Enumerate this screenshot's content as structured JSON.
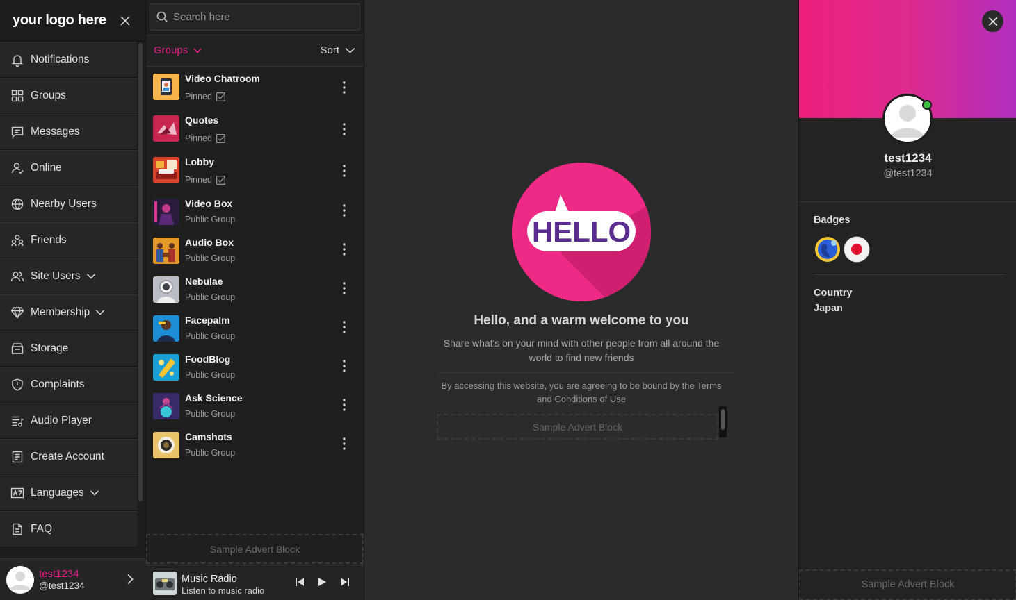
{
  "brand": {
    "logo_text": "your logo here"
  },
  "nav": {
    "items": [
      {
        "label": "Notifications",
        "icon": "bell-icon"
      },
      {
        "label": "Groups",
        "icon": "grid-icon"
      },
      {
        "label": "Messages",
        "icon": "message-icon"
      },
      {
        "label": "Online",
        "icon": "user-check-icon"
      },
      {
        "label": "Nearby Users",
        "icon": "globe-icon"
      },
      {
        "label": "Friends",
        "icon": "friends-icon"
      },
      {
        "label": "Site Users",
        "icon": "users-icon",
        "has_submenu": true
      },
      {
        "label": "Membership",
        "icon": "diamond-icon",
        "has_submenu": true
      },
      {
        "label": "Storage",
        "icon": "storage-icon"
      },
      {
        "label": "Complaints",
        "icon": "shield-icon"
      },
      {
        "label": "Audio Player",
        "icon": "playlist-icon"
      },
      {
        "label": "Create Account",
        "icon": "form-icon"
      },
      {
        "label": "Languages",
        "icon": "language-icon",
        "has_submenu": true
      },
      {
        "label": "FAQ",
        "icon": "document-icon"
      }
    ]
  },
  "current_user": {
    "name": "test1234",
    "handle": "@test1234"
  },
  "search": {
    "placeholder": "Search here",
    "value": ""
  },
  "groups_bar": {
    "tab_label": "Groups",
    "sort_label": "Sort"
  },
  "groups": [
    {
      "name": "Video Chatroom",
      "subtitle": "Pinned",
      "pinned": true,
      "thumb_color": "#f5b34a"
    },
    {
      "name": "Quotes",
      "subtitle": "Pinned",
      "pinned": true,
      "thumb_color": "#c9264f"
    },
    {
      "name": "Lobby",
      "subtitle": "Pinned",
      "pinned": true,
      "thumb_color": "#d8432b"
    },
    {
      "name": "Video Box",
      "subtitle": "Public Group",
      "pinned": false,
      "thumb_color": "#2b1b3c"
    },
    {
      "name": "Audio Box",
      "subtitle": "Public Group",
      "pinned": false,
      "thumb_color": "#e39a2a"
    },
    {
      "name": "Nebulae",
      "subtitle": "Public Group",
      "pinned": false,
      "thumb_color": "#b9bcc4"
    },
    {
      "name": "Facepalm",
      "subtitle": "Public Group",
      "pinned": false,
      "thumb_color": "#1d8ed6"
    },
    {
      "name": "FoodBlog",
      "subtitle": "Public Group",
      "pinned": false,
      "thumb_color": "#1ba0d6"
    },
    {
      "name": "Ask Science",
      "subtitle": "Public Group",
      "pinned": false,
      "thumb_color": "#3b2a6a"
    },
    {
      "name": "Camshots",
      "subtitle": "Public Group",
      "pinned": false,
      "thumb_color": "#e8c36a"
    }
  ],
  "groups_ad": {
    "label": "Sample Advert Block"
  },
  "player": {
    "title": "Music Radio",
    "subtitle": "Listen to music radio"
  },
  "welcome": {
    "title": "Hello, and a warm welcome to you",
    "description": "Share what's on your mind with other people from all around the world to find new friends",
    "terms": "By accessing this website, you are agreeing to be bound by the Terms and Conditions of Use",
    "ad_label": "Sample Advert Block",
    "hello_text": "HELLO"
  },
  "profile": {
    "name": "test1234",
    "handle": "@test1234",
    "badges_label": "Badges",
    "country_label": "Country",
    "country_value": "Japan",
    "ad_label": "Sample Advert Block"
  },
  "colors": {
    "accent": "#e91e8c",
    "online": "#3cc13c",
    "banner_start": "#ee1f7c",
    "banner_end": "#b12fbf"
  }
}
